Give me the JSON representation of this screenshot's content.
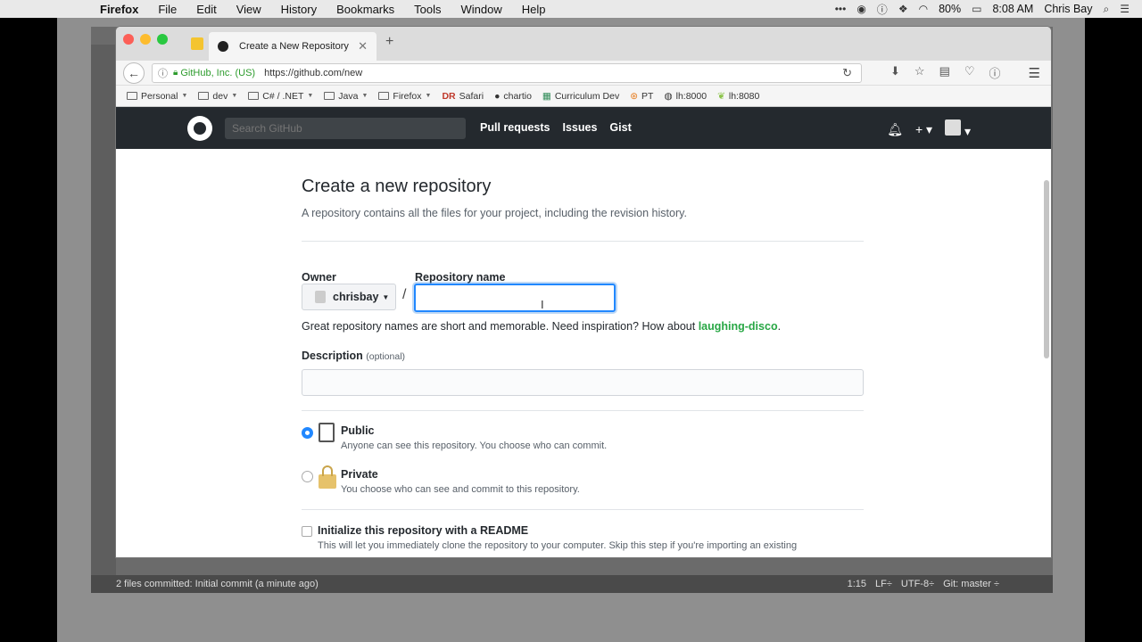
{
  "menubar": {
    "app": "Firefox",
    "items": [
      "File",
      "Edit",
      "View",
      "History",
      "Bookmarks",
      "Tools",
      "Window",
      "Help"
    ],
    "battery": "80%",
    "time": "8:08 AM",
    "user": "Chris Bay"
  },
  "browser": {
    "tab_title": "Create a New Repository",
    "identity": "GitHub, Inc. (US)",
    "url": "https://github.com/new",
    "bookmarks": [
      "Personal",
      "dev",
      "C# / .NET",
      "Java",
      "Firefox",
      "Safari",
      "chartio",
      "Curriculum Dev",
      "PT",
      "lh:8000",
      "lh:8080"
    ]
  },
  "github": {
    "search_placeholder": "Search GitHub",
    "nav": [
      "Pull requests",
      "Issues",
      "Gist"
    ]
  },
  "form": {
    "title": "Create a new repository",
    "subtitle": "A repository contains all the files for your project, including the revision history.",
    "owner_label": "Owner",
    "owner_value": "chrisbay",
    "repo_label": "Repository name",
    "repo_value": "",
    "inspiration_text": "Great repository names are short and memorable. Need inspiration? How about",
    "inspiration_suggestion": "laughing-disco",
    "description_label": "Description",
    "description_optional": "(optional)",
    "public_title": "Public",
    "public_desc": "Anyone can see this repository. You choose who can commit.",
    "private_title": "Private",
    "private_desc": "You choose who can see and commit to this repository.",
    "readme_title": "Initialize this repository with a README",
    "readme_desc": "This will let you immediately clone the repository to your computer. Skip this step if you're importing an existing"
  },
  "ide_status": {
    "left": "2 files committed: Initial commit (a minute ago)",
    "position": "1:15",
    "line_ending": "LF÷",
    "encoding": "UTF-8÷",
    "git": "Git: master ÷"
  },
  "colors": {
    "accent": "#2188ff",
    "suggestion": "#28a745",
    "header": "#24292e"
  }
}
